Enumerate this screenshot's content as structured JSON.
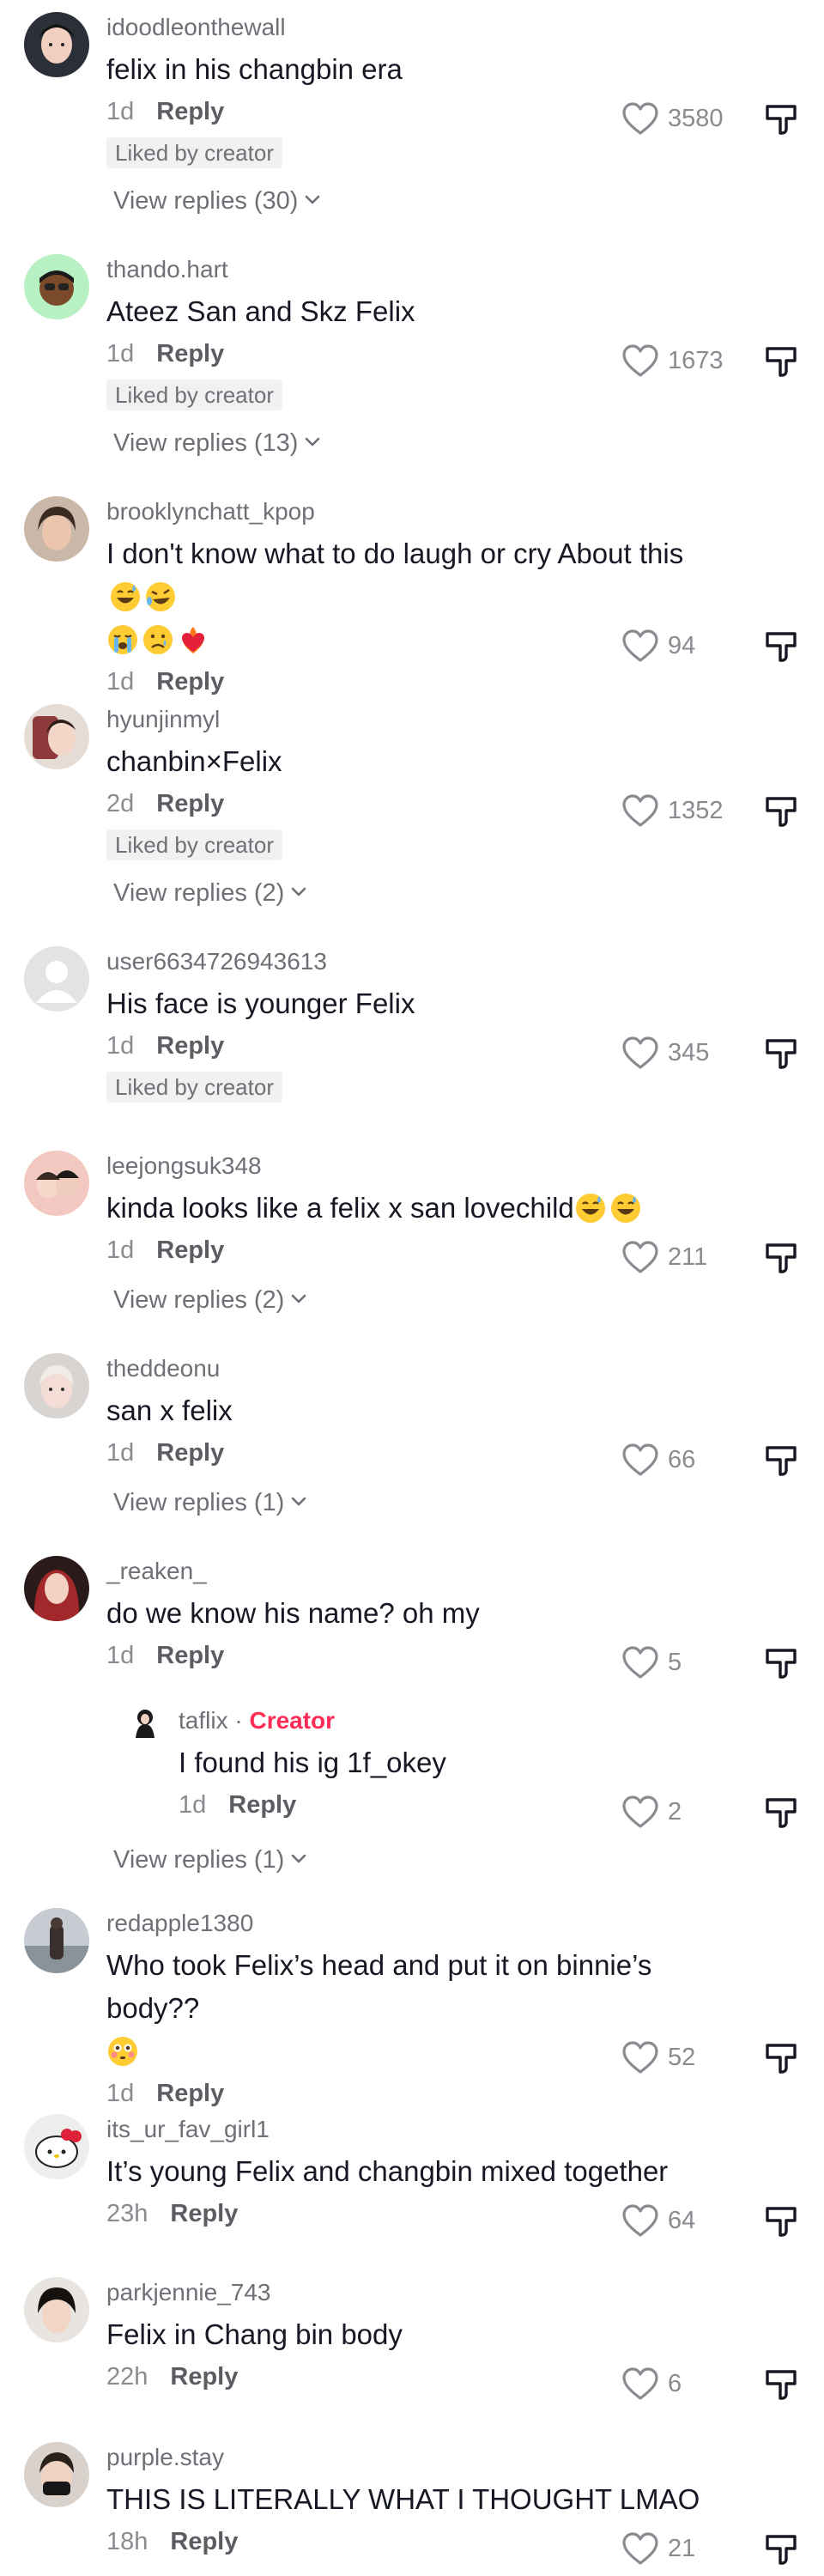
{
  "common": {
    "reply_label": "Reply",
    "liked_by_creator": "Liked by creator",
    "creator_label": "Creator"
  },
  "comments": [
    {
      "username": "idoodleonthewall",
      "text": "felix in his changbin era",
      "time": "1d",
      "likes": "3580",
      "liked_by_creator": true,
      "view_replies": "View replies (30)"
    },
    {
      "username": "thando.hart",
      "text": "Ateez San and Skz Felix",
      "time": "1d",
      "likes": "1673",
      "liked_by_creator": true,
      "view_replies": "View replies (13)"
    },
    {
      "username": "brooklynchatt_kpop",
      "text": "I don't know what to do laugh or cry About this",
      "emojis": [
        "grinning-sweat-emoji",
        "rofl-emoji",
        "loudly-crying-emoji",
        "crying-face-emoji",
        "heart-on-fire-emoji"
      ],
      "time": "1d",
      "likes": "94"
    },
    {
      "username": "hyunjinmyl",
      "text": "chanbin×Felix",
      "time": "2d",
      "likes": "1352",
      "liked_by_creator": true,
      "view_replies": "View replies (2)"
    },
    {
      "username": "user6634726943613",
      "text": "His face is younger Felix",
      "time": "1d",
      "likes": "345",
      "liked_by_creator": true
    },
    {
      "username": "leejongsuk348",
      "text": "kinda looks like a felix x san lovechild",
      "emojis": [
        "grinning-sweat-emoji",
        "grinning-sweat-emoji"
      ],
      "time": "1d",
      "likes": "211",
      "view_replies": "View replies (2)"
    },
    {
      "username": "theddeonu",
      "text": "san x felix",
      "time": "1d",
      "likes": "66",
      "view_replies": "View replies (1)"
    },
    {
      "username": "_reaken_",
      "text": "do we know his name? oh my",
      "time": "1d",
      "likes": "5",
      "view_replies": "View replies (1)"
    },
    {
      "username": "redapple1380",
      "text": "Who took Felix’s head and put it on binnie’s body??",
      "emojis": [
        "flushed-face-emoji"
      ],
      "time": "1d",
      "likes": "52"
    },
    {
      "username": "its_ur_fav_girl1",
      "text": "It’s young Felix and changbin mixed together",
      "time": "23h",
      "likes": "64"
    },
    {
      "username": "parkjennie_743",
      "text": "Felix in Chang bin body",
      "time": "22h",
      "likes": "6"
    },
    {
      "username": "purple.stay",
      "text": "THIS IS LITERALLY WHAT I THOUGHT LMAO",
      "time": "18h",
      "likes": "21"
    }
  ],
  "creator_reply": {
    "username": "taflix",
    "separator": "·",
    "text": "I found his ig 1f_okey",
    "time": "1d",
    "likes": "2"
  },
  "colors": {
    "creator_accent": "#fe2c55",
    "username_gray": "#6f7077",
    "text": "#161823",
    "badge_bg": "#f1f1f2"
  }
}
